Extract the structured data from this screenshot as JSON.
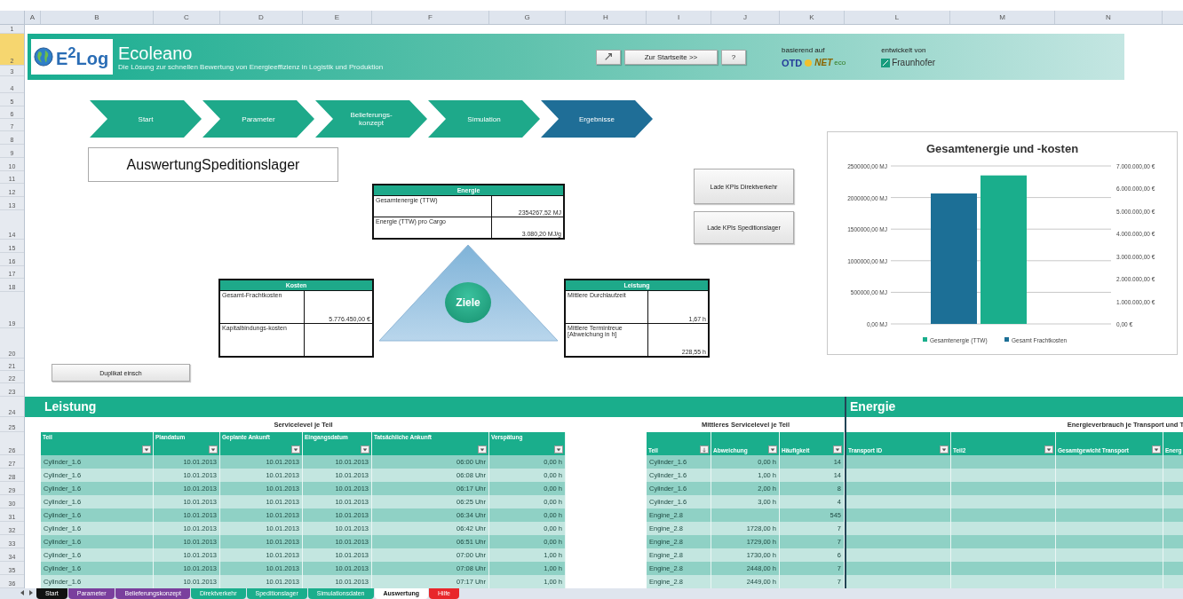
{
  "column_headers": [
    "A",
    "B",
    "C",
    "D",
    "E",
    "F",
    "G",
    "H",
    "I",
    "J",
    "K",
    "L",
    "M",
    "N"
  ],
  "row_headers": [
    {
      "label": "1",
      "selected": false
    },
    {
      "label": "2",
      "selected": true
    },
    {
      "label": "3",
      "selected": false
    },
    {
      "label": "4",
      "selected": false
    },
    {
      "label": "5",
      "selected": false
    },
    {
      "label": "6",
      "selected": false
    },
    {
      "label": "7",
      "selected": false
    },
    {
      "label": "8",
      "selected": false
    },
    {
      "label": "9",
      "selected": false
    },
    {
      "label": "10",
      "selected": false
    },
    {
      "label": "11",
      "selected": false
    },
    {
      "label": "12",
      "selected": false
    },
    {
      "label": "13",
      "selected": false
    },
    {
      "label": "14",
      "selected": false
    },
    {
      "label": "15",
      "selected": false
    },
    {
      "label": "16",
      "selected": false
    },
    {
      "label": "17",
      "selected": false
    },
    {
      "label": "18",
      "selected": false
    },
    {
      "label": "19",
      "selected": false
    },
    {
      "label": "20",
      "selected": false
    },
    {
      "label": "21",
      "selected": false
    },
    {
      "label": "22",
      "selected": false
    },
    {
      "label": "23",
      "selected": false
    },
    {
      "label": "24",
      "selected": false
    },
    {
      "label": "25",
      "selected": false
    },
    {
      "label": "26",
      "selected": false
    },
    {
      "label": "27",
      "selected": false
    },
    {
      "label": "28",
      "selected": false
    },
    {
      "label": "29",
      "selected": false
    },
    {
      "label": "30",
      "selected": false
    },
    {
      "label": "31",
      "selected": false
    },
    {
      "label": "32",
      "selected": false
    },
    {
      "label": "33",
      "selected": false
    },
    {
      "label": "34",
      "selected": false
    },
    {
      "label": "35",
      "selected": false
    },
    {
      "label": "36",
      "selected": false
    }
  ],
  "banner": {
    "logo": "E$^{2}$Log",
    "title": "Ecoleano",
    "subtitle": "Die Lösung zur schnellen Bewertung von Energieeffizienz in Logistik und Produktion",
    "buttons": [
      {
        "kind": "icon"
      },
      {
        "kind": "text",
        "label": "Zur Startseite >>"
      },
      {
        "kind": "text",
        "label": "?"
      }
    ],
    "based_on": {
      "label": "basierend auf",
      "logo_parts": [
        "OTD",
        "NET",
        "eco"
      ]
    },
    "developed_by": {
      "label": "entwickelt von",
      "logo": "Fraunhofer"
    }
  },
  "process_steps": [
    {
      "label": "Start",
      "selected": false
    },
    {
      "label": "Parameter",
      "selected": false
    },
    {
      "label": "Belieferungs-konzept",
      "selected": false
    },
    {
      "label": "Simulation",
      "selected": false
    },
    {
      "label": "Ergebnisse",
      "selected": true
    }
  ],
  "sheet_title": "AuswertungSpeditionslager",
  "kpi_buttons": [
    "Lade KPIs Direktverkehr",
    "Lade KPIs Speditionslager"
  ],
  "goals": {
    "center": "Ziele",
    "energy": {
      "title": "Energie",
      "rows": [
        {
          "label": "Gesamtenergie (TTW)",
          "value": "2354267,52 MJ"
        },
        {
          "label": "Energie (TTW) pro Cargo",
          "value": "3.080,20 MJ/g"
        }
      ]
    },
    "costs": {
      "title": "Kosten",
      "rows": [
        {
          "label": "Gesamt-Frachtkosten",
          "value": "5.776.450,00 €"
        },
        {
          "label": "Kapitalbindungs-kosten"
        }
      ]
    },
    "performance": {
      "title": "Leistung",
      "rows": [
        {
          "label": "Mittlere Durchlaufzeit",
          "value": "1,67 h"
        },
        {
          "label": "Mittlere Termintreue [Abweichung in h]",
          "value": "228,55 h"
        }
      ]
    }
  },
  "duplicate_button": "Duplikat einsch",
  "chart": {
    "chart_data": {
      "type": "bar",
      "title": "Gesamtenergie und -kosten",
      "series": [
        {
          "name": "Gesamt Frachtkosten",
          "color": "#1c6f96",
          "values": [
            5780000
          ],
          "axis": "y2"
        },
        {
          "name": "Gesamtenergie (TTW)",
          "color": "#1aae8c",
          "values": [
            2350000
          ]
        }
      ],
      "grid": true,
      "legend": "bottom",
      "ylim": [
        0,
        2500000
      ],
      "yticks": [
        {
          "value": 0,
          "label": "0,00 MJ"
        },
        {
          "value": 500000,
          "label": "500000,00 MJ"
        },
        {
          "value": 1000000,
          "label": "1000000,00 MJ"
        },
        {
          "value": 1500000,
          "label": "1500000,00 MJ"
        },
        {
          "value": 2000000,
          "label": "2000000,00 MJ"
        },
        {
          "value": 2500000,
          "label": "2500000,00 MJ"
        }
      ],
      "y2lim": [
        0,
        7000000
      ],
      "y2ticks": [
        {
          "value": 0,
          "label": "0,00 €"
        },
        {
          "value": 1000000,
          "label": "1.000.000,00 €"
        },
        {
          "value": 2000000,
          "label": "2.000.000,00 €"
        },
        {
          "value": 3000000,
          "label": "3.000.000,00 €"
        },
        {
          "value": 4000000,
          "label": "4.000.000,00 €"
        },
        {
          "value": 5000000,
          "label": "5.000.000,00 €"
        },
        {
          "value": 6000000,
          "label": "6.000.000,00 €"
        },
        {
          "value": 7000000,
          "label": "7.000.000,00 €"
        }
      ]
    }
  },
  "sections": [
    {
      "title": "Leistung"
    },
    {
      "title": "Energie"
    }
  ],
  "service_table": {
    "title": "Servicelevel je Teil",
    "columns": [
      {
        "label": "Teil",
        "kind": "filter"
      },
      {
        "label": "Plandatum",
        "kind": "filter"
      },
      {
        "label": "Geplante Ankunft",
        "kind": "filter"
      },
      {
        "label": "Eingangsdatum",
        "kind": "filter"
      },
      {
        "label": "Tatsächliche Ankunft",
        "kind": "filter"
      },
      {
        "label": "Verspätung",
        "kind": "filter"
      }
    ],
    "rows": [
      [
        "Cylinder_1.6",
        "10.01.2013",
        "10.01.2013",
        "10.01.2013",
        "06:00 Uhr",
        "0,00 h"
      ],
      [
        "Cylinder_1.6",
        "10.01.2013",
        "10.01.2013",
        "10.01.2013",
        "06:08 Uhr",
        "0,00 h"
      ],
      [
        "Cylinder_1.6",
        "10.01.2013",
        "10.01.2013",
        "10.01.2013",
        "06:17 Uhr",
        "0,00 h"
      ],
      [
        "Cylinder_1.6",
        "10.01.2013",
        "10.01.2013",
        "10.01.2013",
        "06:25 Uhr",
        "0,00 h"
      ],
      [
        "Cylinder_1.6",
        "10.01.2013",
        "10.01.2013",
        "10.01.2013",
        "06:34 Uhr",
        "0,00 h"
      ],
      [
        "Cylinder_1.6",
        "10.01.2013",
        "10.01.2013",
        "10.01.2013",
        "06:42 Uhr",
        "0,00 h"
      ],
      [
        "Cylinder_1.6",
        "10.01.2013",
        "10.01.2013",
        "10.01.2013",
        "06:51 Uhr",
        "0,00 h"
      ],
      [
        "Cylinder_1.6",
        "10.01.2013",
        "10.01.2013",
        "10.01.2013",
        "07:00 Uhr",
        "1,00 h"
      ],
      [
        "Cylinder_1.6",
        "10.01.2013",
        "10.01.2013",
        "10.01.2013",
        "07:08 Uhr",
        "1,00 h"
      ],
      [
        "Cylinder_1.6",
        "10.01.2013",
        "10.01.2013",
        "10.01.2013",
        "07:17 Uhr",
        "1,00 h"
      ]
    ]
  },
  "mean_table": {
    "title": "Mittleres Servicelevel je Teil",
    "columns": [
      {
        "label": "Teil",
        "kind": "sorted"
      },
      {
        "label": "Abweichung",
        "kind": "filter"
      },
      {
        "label": "Häufigkeit",
        "kind": "filter"
      }
    ],
    "rows": [
      [
        "Cylinder_1.6",
        "0,00 h",
        "14"
      ],
      [
        "Cylinder_1.6",
        "1,00 h",
        "14"
      ],
      [
        "Cylinder_1.6",
        "2,00 h",
        "8"
      ],
      [
        "Cylinder_1.6",
        "3,00 h",
        "4"
      ],
      [
        "Engine_2.8",
        null,
        "545"
      ],
      [
        "Engine_2.8",
        "1728,00 h",
        "7"
      ],
      [
        "Engine_2.8",
        "1729,00 h",
        "7"
      ],
      [
        "Engine_2.8",
        "1730,00 h",
        "6"
      ],
      [
        "Engine_2.8",
        "2448,00 h",
        "7"
      ],
      [
        "Engine_2.8",
        "2449,00 h",
        "7"
      ]
    ]
  },
  "energy_table": {
    "title": "Energieverbrauch je Transport und T",
    "columns": [
      {
        "label": "Transport ID",
        "kind": "filter"
      },
      {
        "label": "Teil2",
        "kind": "filter"
      },
      {
        "label": "Gesamtgewicht Transport",
        "kind": "filter"
      },
      {
        "label": "Energ"
      }
    ]
  },
  "sheet_tabs": [
    {
      "label": "Start",
      "selected": false,
      "color": "#111111"
    },
    {
      "label": "Parameter",
      "selected": false,
      "color": "#7a3f9d"
    },
    {
      "label": "Belieferungskonzept",
      "selected": false,
      "color": "#7a3f9d"
    },
    {
      "label": "Direktverkehr",
      "selected": false,
      "color": "#1aae8c"
    },
    {
      "label": "Speditionslager",
      "selected": false,
      "color": "#1aae8c"
    },
    {
      "label": "Simulationsdaten",
      "selected": false,
      "color": "#1aae8c"
    },
    {
      "label": "Auswertung",
      "selected": true
    },
    {
      "label": "Hilfe",
      "selected": false,
      "color": "#e8262b"
    }
  ]
}
